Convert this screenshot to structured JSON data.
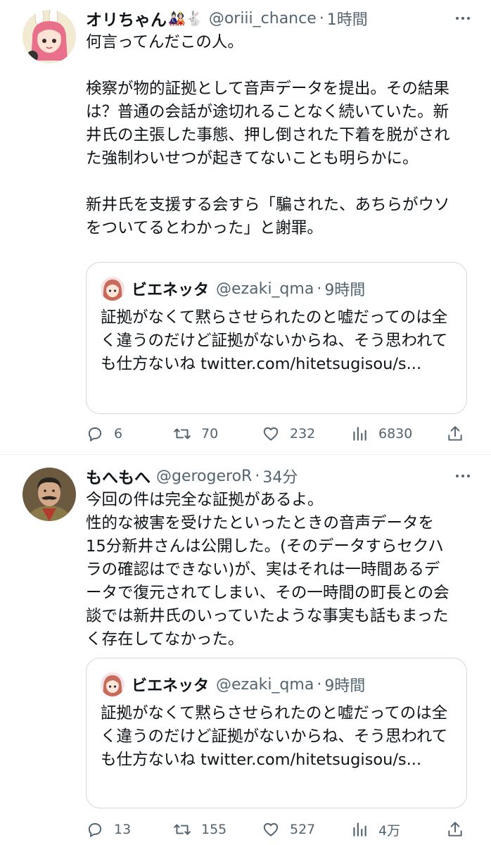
{
  "tweets": [
    {
      "display_name": "オリちゃん",
      "name_emoji": "🎎🐇",
      "handle": "@oriii_chance",
      "separator": "·",
      "time": "1時間",
      "text": "何言ってんだこの人。\n\n検察が物的証拠として音声データを提出。その結果は？普通の会話が途切れることなく続いていた。新井氏の主張した事態、押し倒された下着を脱がされた強制わいせつが起きてないことも明らかに。\n\n新井氏を支援する会すら「騙された、あちらがウソをついてるとわかった」と謝罪。",
      "quote": {
        "display_name": "ビエネッタ",
        "handle": "@ezaki_qma",
        "separator": "·",
        "time": "9時間",
        "text": "証拠がなくて黙らさせられたのと嘘だってのは全く違うのだけど証拠がないからね、そう思われても仕方ないね twitter.com/hitetsugisou/s..."
      },
      "stats": {
        "replies": "6",
        "retweets": "70",
        "likes": "232",
        "views": "6830"
      }
    },
    {
      "display_name": "もへもへ",
      "name_emoji": "",
      "handle": "@gerogeroR",
      "separator": "·",
      "time": "34分",
      "text": "今回の件は完全な証拠があるよ。\n性的な被害を受けたといったときの音声データを15分新井さんは公開した。(そのデータすらセクハラの確認はできない)が、実はそれは一時間あるデータで復元されてしまい、その一時間の町長との会談では新井氏のいっていたような事実も話もまったく存在してなかった。",
      "quote": {
        "display_name": "ビエネッタ",
        "handle": "@ezaki_qma",
        "separator": "·",
        "time": "9時間",
        "text": "証拠がなくて黙らさせられたのと嘘だってのは全く違うのだけど証拠がないからね、そう思われても仕方ないね twitter.com/hitetsugisou/s..."
      },
      "stats": {
        "replies": "13",
        "retweets": "155",
        "likes": "527",
        "views": "4万"
      }
    }
  ],
  "icons": [
    "more-icon",
    "reply-icon",
    "retweet-icon",
    "like-icon",
    "views-icon",
    "share-icon"
  ],
  "colors": {
    "text": "#0f1419",
    "secondary": "#536471",
    "border": "#cfd9de",
    "divider": "#eff3f4"
  }
}
